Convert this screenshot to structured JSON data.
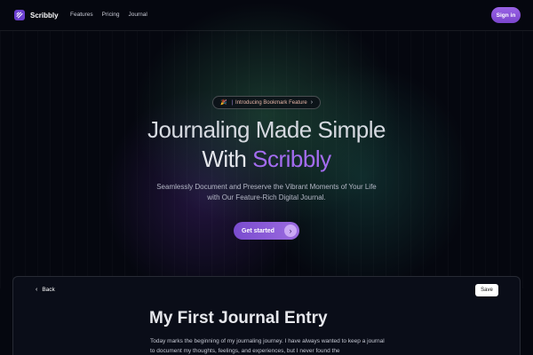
{
  "nav": {
    "brand": "Scribbly",
    "links": [
      "Features",
      "Pricing",
      "Journal"
    ],
    "signin_label": "Sign in"
  },
  "hero": {
    "badge": {
      "icon": "party-popper-icon",
      "separator": "|",
      "label": "Introducing Bookmark Feature",
      "chevron": "›"
    },
    "headline_line1": "Journaling Made Simple",
    "headline_line2_prefix": "With",
    "headline_line2_brand": "Scribbly",
    "subtitle": "Seamlessly Document and Preserve the Vibrant Moments of Your Life with Our Feature-Rich Digital Journal.",
    "cta_label": "Get started",
    "cta_arrow": "›"
  },
  "editor": {
    "back_label": "Back",
    "back_chevron": "‹",
    "save_label": "Save",
    "title": "My First Journal Entry",
    "body": "Today marks the beginning of my journaling journey. I have always wanted to keep a journal to document my thoughts, feelings, and experiences, but I never found the"
  },
  "colors": {
    "accent": "#9a63e6",
    "background": "#05070f",
    "brand_word": "#a46cf0"
  }
}
